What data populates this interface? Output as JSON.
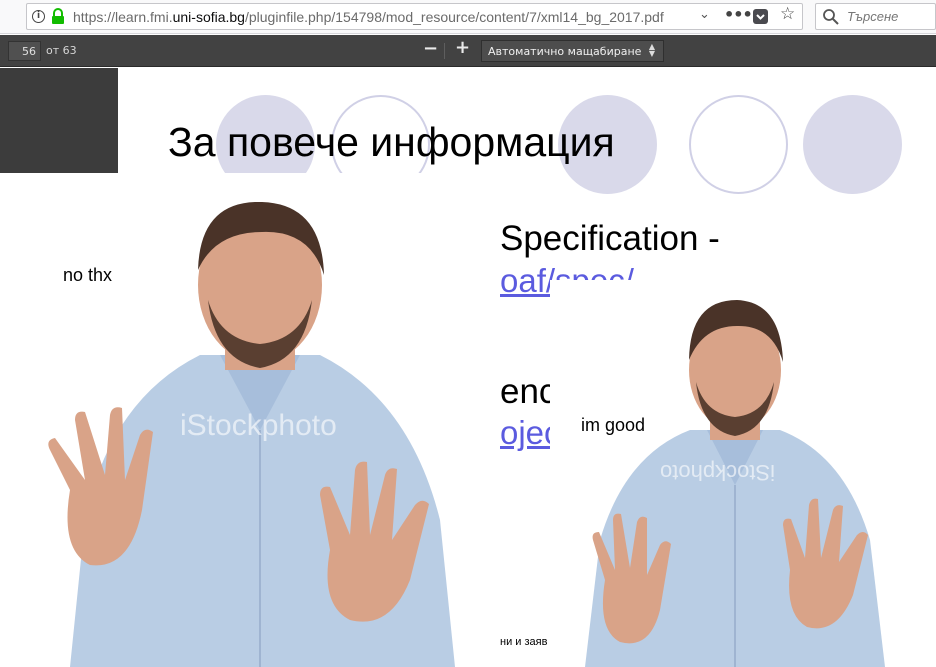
{
  "browser": {
    "url_prefix": "https://learn.fmi.",
    "url_domain": "uni-sofia.bg",
    "url_suffix": "/pluginfile.php/154798/mod_resource/content/7/xml14_bg_2017.pdf",
    "search_placeholder": "Търсене",
    "info_icon_glyph": "i",
    "chevron_glyph": "⌄",
    "more_glyph": "•••",
    "star_glyph": "☆"
  },
  "pdf_toolbar": {
    "page_number": "56",
    "page_of": "от 63",
    "zoom_out": "−",
    "zoom_in": "+",
    "zoom_mode": "Автоматично мащабиране"
  },
  "slide": {
    "title": "За повече информация",
    "line1": "Specification -",
    "link1": "oaf/spec/",
    "line2": "enc",
    "link2": "ojec",
    "footer": "ни и заяв"
  },
  "meme": {
    "caption_left": "no thx",
    "caption_right": "im good",
    "watermark": "iStockphoto"
  },
  "colors": {
    "toolbar_bg": "#424242",
    "circle_fill": "#d9d9ea",
    "circle_outline": "#d0d0e6",
    "link": "#5b5bdf",
    "shirt": "#b9cde4",
    "skin": "#d9a388",
    "hair": "#4a3328"
  }
}
